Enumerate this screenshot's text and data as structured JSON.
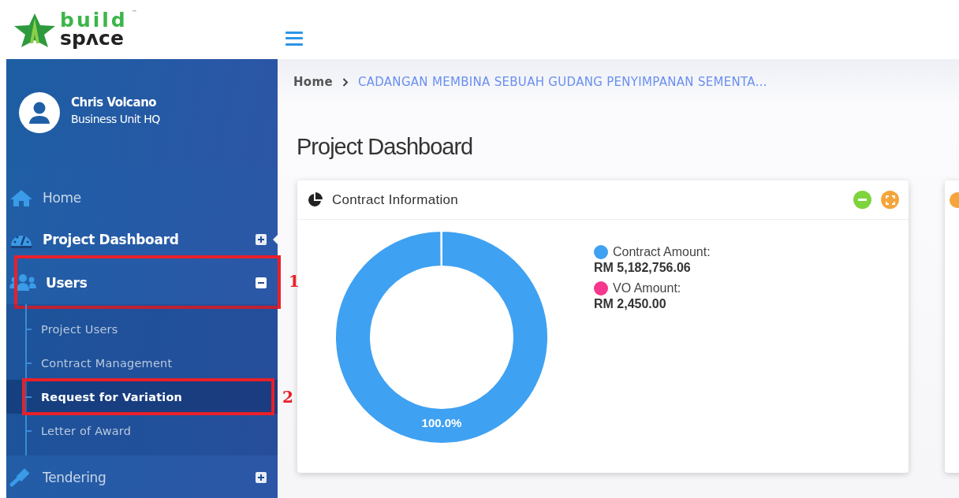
{
  "logo": {
    "top": "build",
    "bottom": "spʌce",
    "mark": "™"
  },
  "user": {
    "name": "Chris Volcano",
    "unit": "Business Unit HQ"
  },
  "sidebar": {
    "items": [
      {
        "kind": "home",
        "label": "Home",
        "selected": false
      },
      {
        "kind": "gauge",
        "label": "Project Dashboard",
        "selected": true,
        "expanded": false
      },
      {
        "kind": "users",
        "label": "Users",
        "selected": true,
        "expanded": true,
        "annotation": "1",
        "children": [
          {
            "label": "Project Users",
            "selected": false
          },
          {
            "label": "Contract Management",
            "selected": false
          },
          {
            "label": "Request for Variation",
            "selected": true,
            "annotation": "2"
          },
          {
            "label": "Letter of Award",
            "selected": false
          }
        ]
      },
      {
        "kind": "hammer",
        "label": "Tendering",
        "selected": false,
        "expanded": false
      }
    ]
  },
  "breadcrumb": [
    "Home",
    "CADANGAN MEMBINA SEBUAH GUDANG PENYIMPANAN SEMENTA..."
  ],
  "page_title": "Project Dashboard",
  "card": {
    "title": "Contract Information",
    "legend": [
      {
        "separator": ":",
        "value": "RM 5,182,756.06",
        "color": "#3fa1f2"
      },
      {
        "separator": ":",
        "value": "RM 2,450.00",
        "color": "#f5378e"
      }
    ],
    "chart_data": {
      "type": "donut",
      "categories": [
        "Contract Amount",
        "VO Amount"
      ],
      "values": [
        99.95,
        0.05
      ],
      "colors": [
        "#3fa1f2",
        "#f5378e"
      ],
      "value_labels": [
        "100.0%",
        null
      ]
    }
  }
}
